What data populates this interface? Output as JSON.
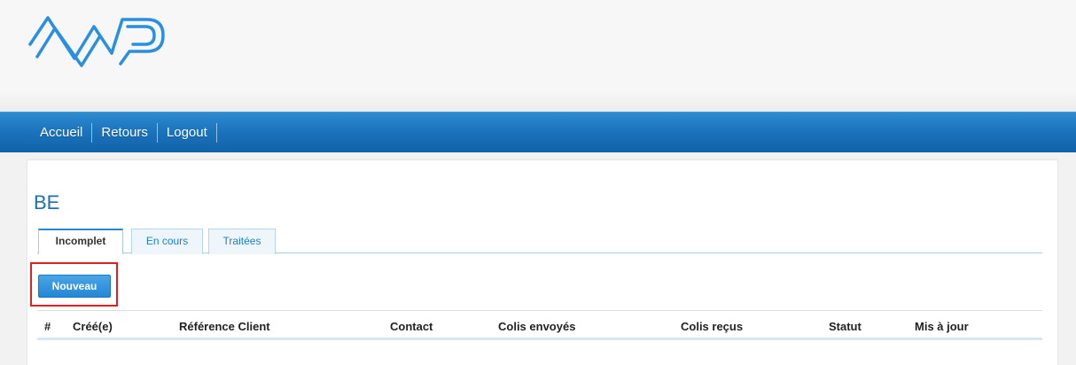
{
  "logo": {
    "alt": "MP",
    "color": "#2a8fe0"
  },
  "nav": {
    "items": [
      {
        "label": "Accueil"
      },
      {
        "label": "Retours"
      },
      {
        "label": "Logout"
      }
    ]
  },
  "page": {
    "title": "BE"
  },
  "tabs": [
    {
      "label": "Incomplet",
      "active": true
    },
    {
      "label": "En cours",
      "active": false
    },
    {
      "label": "Traitées",
      "active": false
    }
  ],
  "actions": {
    "new_label": "Nouveau"
  },
  "table": {
    "columns": [
      "#",
      "Créé(e)",
      "Référence Client",
      "Contact",
      "Colis envoyés",
      "Colis reçus",
      "Statut",
      "Mis à jour"
    ]
  },
  "colors": {
    "accent": "#1b6fb8",
    "navbar": "#1c74bd",
    "highlight": "#e02020"
  }
}
